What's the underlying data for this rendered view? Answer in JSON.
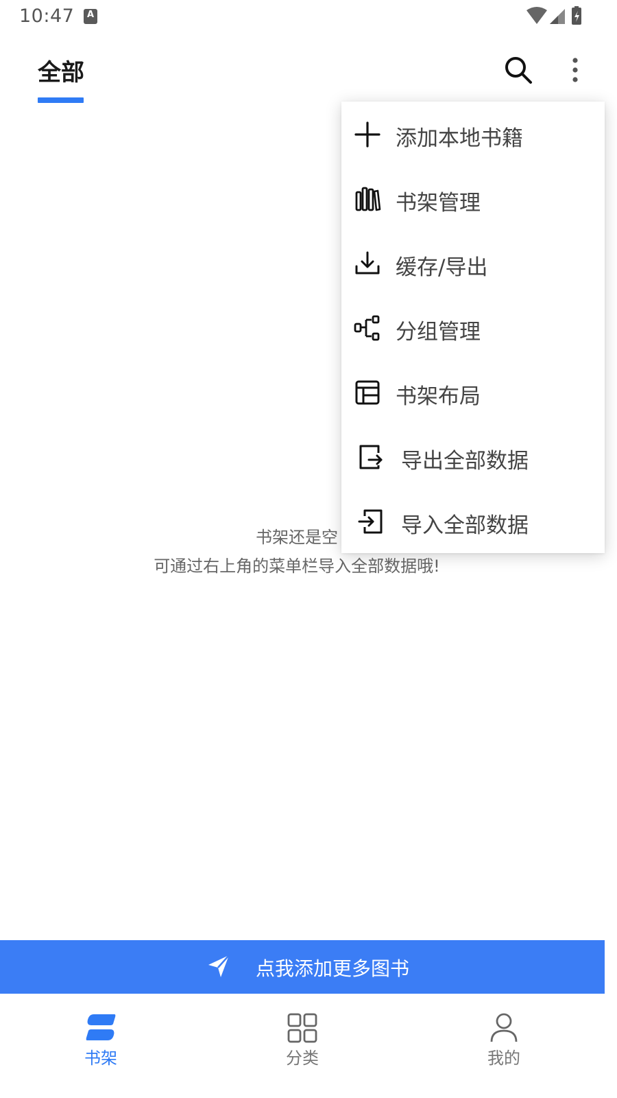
{
  "status_bar": {
    "time": "10:47",
    "notification_icon_letter": "A"
  },
  "header": {
    "tab_label": "全部",
    "accent_color": "#2f7bf5",
    "search_icon": "search-icon",
    "more_icon": "more-vertical-icon"
  },
  "empty": {
    "line1": "书架还是空",
    "line2": "可通过右上角的菜单栏导入全部数据哦!"
  },
  "menu": {
    "items": [
      {
        "label": "添加本地书籍",
        "icon": "plus-icon"
      },
      {
        "label": "书架管理",
        "icon": "bookshelf-icon"
      },
      {
        "label": "缓存/导出",
        "icon": "download-icon"
      },
      {
        "label": "分组管理",
        "icon": "group-icon"
      },
      {
        "label": "书架布局",
        "icon": "layout-icon"
      },
      {
        "label": "导出全部数据",
        "icon": "export-icon"
      },
      {
        "label": "导入全部数据",
        "icon": "import-icon"
      }
    ]
  },
  "banner": {
    "label": "点我添加更多图书",
    "icon": "send-icon",
    "color": "#3b7df5"
  },
  "bottom_nav": {
    "items": [
      {
        "label": "书架",
        "icon": "bookshelf-nav-icon",
        "active": true
      },
      {
        "label": "分类",
        "icon": "category-grid-icon",
        "active": false
      },
      {
        "label": "我的",
        "icon": "profile-icon",
        "active": false
      }
    ]
  }
}
